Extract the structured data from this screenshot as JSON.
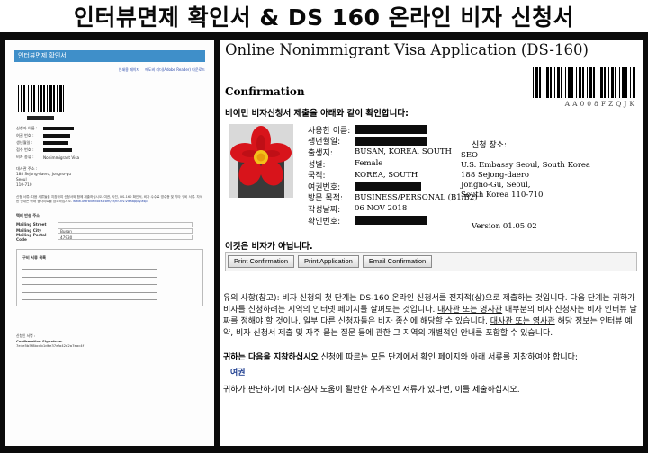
{
  "banner": {
    "title": "인터뷰면제 확인서 & DS 160 온라인 비자 신청서"
  },
  "colors": {
    "header_blue": "#3f8fc9",
    "link_blue": "#2545a8",
    "passport_blue": "#1d3d8f",
    "background": "#0b0b0b"
  },
  "left_panel": {
    "header": "인터뷰면제 확인서",
    "links": [
      "인쇄용 페이지",
      "에도비 리더(Adobe Reader) 다운로드"
    ],
    "fields": [
      {
        "label": "신청자 이름 :",
        "redacted": true
      },
      {
        "label": "여권 번호 :",
        "redacted": true
      },
      {
        "label": "생년월일 :",
        "redacted": true
      },
      {
        "label": "접수 번호 :",
        "redacted": true
      },
      {
        "label": "비자 종류 :",
        "value": "Nonimmigrant Visa"
      }
    ],
    "address_lines": [
      "대사관 주소 :",
      "188 Sejong-daero, Jongno-gu",
      "Seoul",
      "110-710"
    ],
    "paragraph": "신청 서류: 다음 서류들을 지참하여 신청서와 함께 제출하십시오. 여권, 사진, DS-160 확인서, 비자 수수료 영수증 및 기타 구비 서류. 자세한 안내는 아래 웹사이트를 참조하십시오.",
    "link_text": "www.ustraveldocs.com/kr/kr-niv-visaapply.asp",
    "form_heading": "택배 반송 주소",
    "form_rows": [
      {
        "label": "Mailing Street",
        "value": ""
      },
      {
        "label": "Mailing City",
        "value": "Busan"
      },
      {
        "label": "Mailing Postal Code",
        "value": "47930"
      }
    ],
    "list_heading": "구비 서류 목록",
    "footer_label": "신청인 서명 :",
    "footer_confirm": "Confirmation Signature:",
    "footer_code": "7e4e5b5f8bcdb1d6e37efa42e2a7eac4f"
  },
  "right_panel": {
    "title": "Online Nonimmigrant Visa Application (DS-160)",
    "confirmation": "Confirmation",
    "barcode_code": "AA008FZQJK",
    "instruction": "비이민 비자신청서 제출을 아래와 같이 확인합니다:",
    "info_rows": [
      {
        "label": "사용한 이름:",
        "redacted": true,
        "redact_w": 80
      },
      {
        "label": "생년월일:",
        "redacted": true,
        "redact_w": 80
      },
      {
        "label": "출생지:",
        "value": "BUSAN, KOREA, SOUTH"
      },
      {
        "label": "성별:",
        "value": "Female"
      },
      {
        "label": "국적:",
        "value": "KOREA, SOUTH"
      },
      {
        "label": "여권번호:",
        "redacted": true,
        "redact_w": 74
      },
      {
        "label": "방문 목적:",
        "value": "BUSINESS/PERSONAL (B1/B2)"
      },
      {
        "label": "작성날짜:",
        "value": "06 NOV 2018"
      },
      {
        "label": "확인번호:",
        "redacted": true,
        "redact_w": 80
      }
    ],
    "application_location": {
      "label": "신청 장소:",
      "lines": [
        "SEO",
        "U.S. Embassy Seoul, South Korea",
        "188 Sejong-daero",
        "Jongno-Gu, Seoul,",
        "South Korea 110-710"
      ]
    },
    "version": "Version 01.05.02",
    "not_visa": "이것은 비자가 아닙니다.",
    "buttons": {
      "print_confirmation": "Print Confirmation",
      "print_application": "Print Application",
      "email_confirmation": "Email Confirmation"
    },
    "notice": {
      "part1": "유의 사항(참고): 비자 신청의 첫 단계는 DS-160 온라인 신청서를 전자적(상)으로 제출하는 것입니다. 다음 단계는 귀하가 비자를 신청하려는 지역의 인터넷 페이지를 살펴보는 것입니다. ",
      "link1": "대사관 또는 영사관",
      "part2": " 대부분의 비자 신청자는 비자 인터뷰 날짜를 정해야 할 것이나, 일부 다른 신청자들은 비자 종신에 해당할 수 있습니다. ",
      "link2": "대사관 또는 영사관",
      "part3": " 해당 정보는 인터뷰 예약, 비자 신청서 제출 및 자주 묻는 질문 등에 관한 그 지역의 개별적인 안내를 포함할 수 있습니다."
    },
    "notice2": {
      "bold": "귀하는 다음을 지참하십시오",
      "rest": " 신청에 따르는 모든 단계에서 확인 페이지와 아래 서류를 지참하여야 합니다:"
    },
    "passport": "여권",
    "notice3": "귀하가 판단하기에 비자심사 도움이 될만한 추가적인 서류가 있다면, 이를 제출하십시오."
  }
}
